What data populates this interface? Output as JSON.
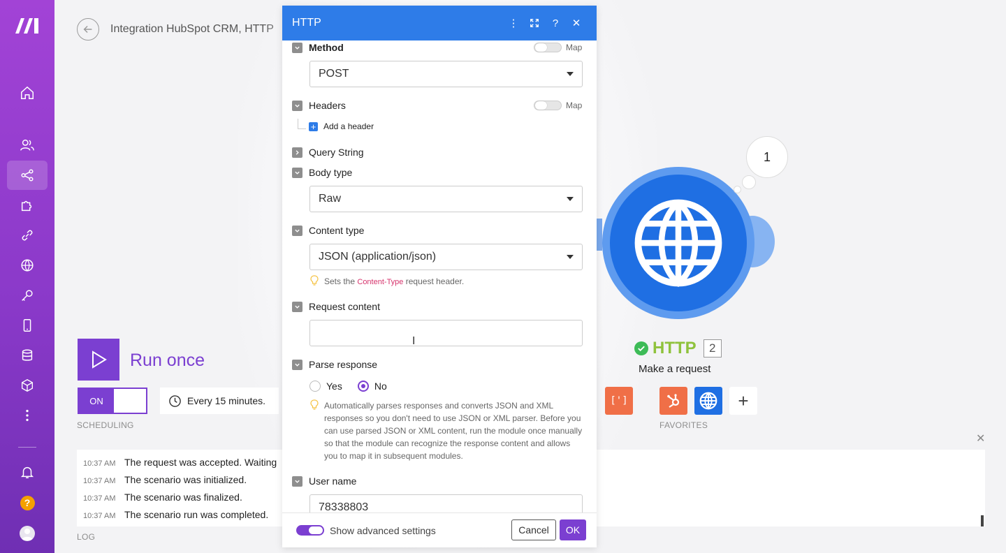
{
  "header": {
    "title": "Integration HubSpot CRM, HTTP"
  },
  "run": {
    "label": "Run once"
  },
  "scheduling": {
    "toggle_label": "ON",
    "interval": "Every 15 minutes.",
    "caption": "SCHEDULING"
  },
  "favorites": {
    "caption": "FAVORITES"
  },
  "log": {
    "caption": "LOG",
    "rows": [
      {
        "time": "10:37 AM",
        "message": "The request was accepted. Waiting"
      },
      {
        "time": "10:37 AM",
        "message": "The scenario was initialized."
      },
      {
        "time": "10:37 AM",
        "message": "The scenario was finalized."
      },
      {
        "time": "10:37 AM",
        "message": "The scenario run was completed."
      }
    ]
  },
  "node": {
    "name": "HTTP",
    "number": "2",
    "subtitle": "Make a request",
    "bubble_count": "1"
  },
  "modal": {
    "title": "HTTP",
    "map_label": "Map",
    "method": {
      "label": "Method",
      "value": "POST"
    },
    "headers": {
      "label": "Headers",
      "add_label": "Add a header"
    },
    "query_string": {
      "label": "Query String"
    },
    "body_type": {
      "label": "Body type",
      "value": "Raw"
    },
    "content_type": {
      "label": "Content type",
      "value": "JSON (application/json)",
      "hint_pre": "Sets the",
      "hint_code": "Content-Type",
      "hint_post": "request header."
    },
    "request_content": {
      "label": "Request content",
      "value": ""
    },
    "parse_response": {
      "label": "Parse response",
      "yes": "Yes",
      "no": "No",
      "selected": "No",
      "hint": "Automatically parses responses and converts JSON and XML responses so you don't need to use JSON or XML parser. Before you can use parsed JSON or XML content, run the module once manually so that the module can recognize the response content and allows you to map it in subsequent modules."
    },
    "user_name": {
      "label": "User name",
      "value": "78338803"
    },
    "footer": {
      "advanced_label": "Show advanced settings",
      "cancel": "Cancel",
      "ok": "OK"
    }
  },
  "colors": {
    "brand_purple": "#7b3fd1",
    "http_blue": "#1f6fe3",
    "modal_header": "#2e7ce8",
    "hubspot_orange": "#f06f47",
    "success_green": "#3dbb57"
  }
}
